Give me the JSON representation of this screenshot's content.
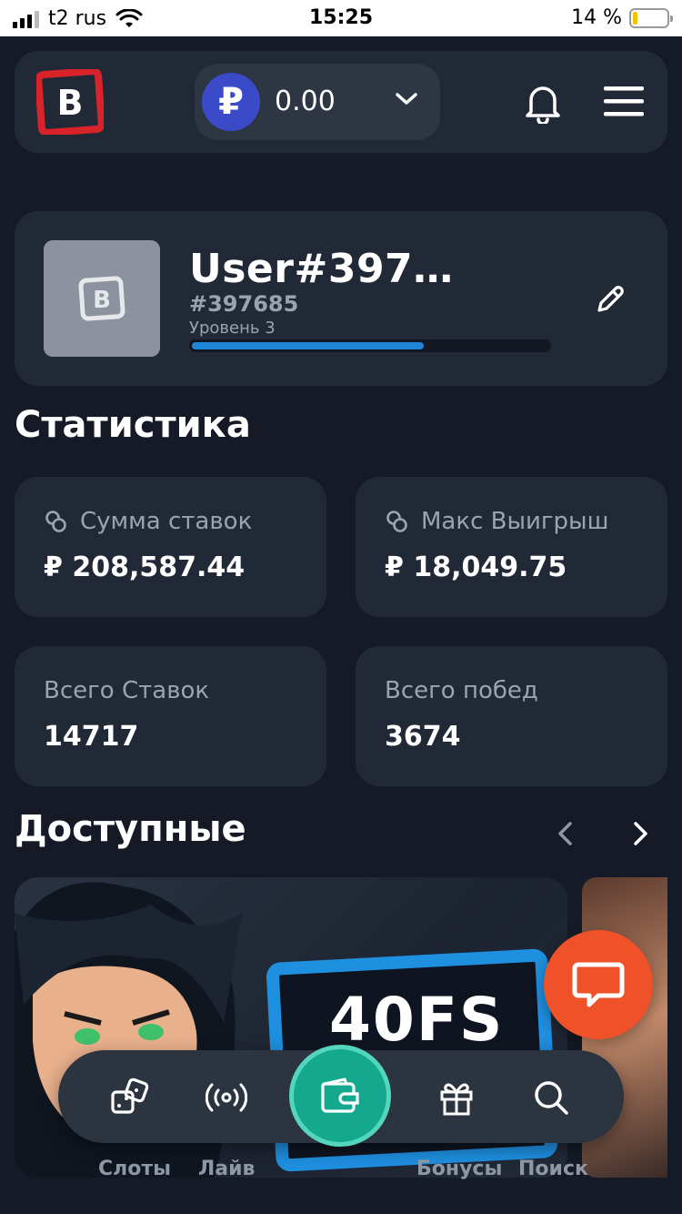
{
  "status_bar": {
    "carrier": "t2 rus",
    "time": "15:25",
    "battery": "14 %"
  },
  "header": {
    "balance": "0.00",
    "currency_symbol": "₽"
  },
  "profile": {
    "username": "User#397…",
    "user_id": "#397685",
    "level": "Уровень 3",
    "level_progress": 0.64
  },
  "stats": {
    "title": "Статистика",
    "cards": [
      {
        "label": "Сумма ставок",
        "value": "₽ 208,587.44"
      },
      {
        "label": "Макс Выигрыш",
        "value": "₽ 18,049.75"
      },
      {
        "label": "Всего Ставок",
        "value": "14717"
      },
      {
        "label": "Всего побед",
        "value": "3674"
      }
    ]
  },
  "available": {
    "title": "Доступные",
    "banner_text": "40FS"
  },
  "bottom_nav": {
    "slots": "Слоты",
    "live": "Лайв",
    "bonuses": "Бонусы",
    "search": "Поиск"
  },
  "colors": {
    "accent": "#14a88e",
    "chat": "#ef5128",
    "progress": "#1d86d6",
    "brand_red": "#d8232a"
  }
}
